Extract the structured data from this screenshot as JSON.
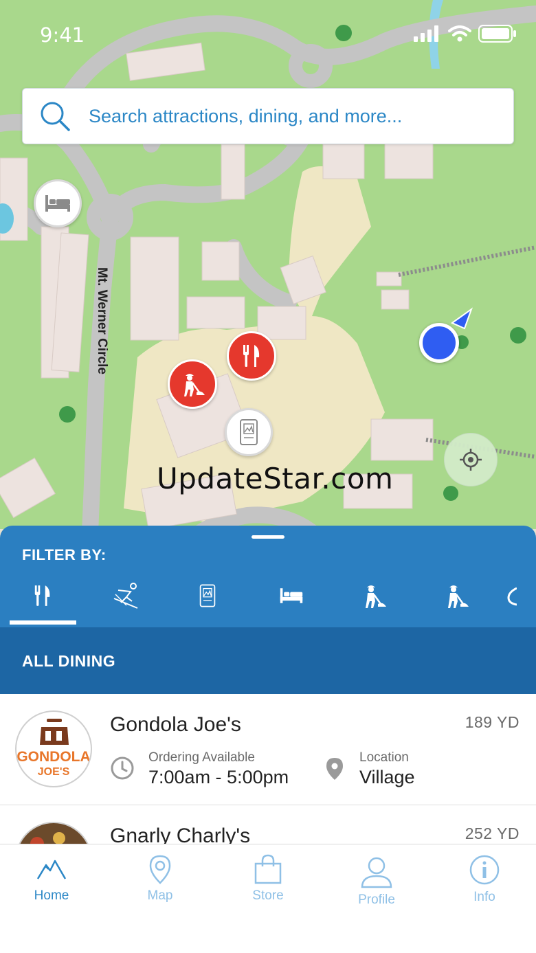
{
  "status_bar": {
    "time": "9:41"
  },
  "search": {
    "placeholder": "Search attractions, dining, and more..."
  },
  "map": {
    "road_label": "Mt. Werner Circle",
    "watermark": "UpdateStar.com",
    "pins": [
      {
        "name": "lodging",
        "icon": "bed-icon",
        "style": "white"
      },
      {
        "name": "dining",
        "icon": "fork-knife-icon",
        "style": "red"
      },
      {
        "name": "trail-work",
        "icon": "worker-icon",
        "style": "red"
      },
      {
        "name": "trail-map",
        "icon": "trail-map-icon",
        "style": "white"
      }
    ]
  },
  "filter": {
    "label": "FILTER BY:",
    "tabs": [
      {
        "name": "dining",
        "icon": "fork-knife-icon",
        "selected": true
      },
      {
        "name": "skiing",
        "icon": "skier-icon",
        "selected": false
      },
      {
        "name": "trail-map",
        "icon": "trail-map-icon",
        "selected": false
      },
      {
        "name": "lodging",
        "icon": "bed-icon",
        "selected": false
      },
      {
        "name": "grooming-1",
        "icon": "worker-icon",
        "selected": false
      },
      {
        "name": "grooming-2",
        "icon": "worker-icon",
        "selected": false
      },
      {
        "name": "more",
        "icon": "partial-icon",
        "selected": false
      }
    ]
  },
  "category": {
    "title": "ALL DINING"
  },
  "list": {
    "items": [
      {
        "name": "Gondola Joe's",
        "distance": "189 YD",
        "hours_label": "Ordering Available",
        "hours_value": "7:00am - 5:00pm",
        "location_label": "Location",
        "location_value": "Village",
        "logo_text_1": "GONDOLA",
        "logo_text_2": "JOE'S"
      },
      {
        "name": "Gnarly Charly's",
        "distance": "252 YD"
      }
    ]
  },
  "tab_bar": {
    "tabs": [
      {
        "label": "Home",
        "icon": "mountain-icon",
        "active": true
      },
      {
        "label": "Map",
        "icon": "map-pin-icon",
        "active": false
      },
      {
        "label": "Store",
        "icon": "shopping-bag-icon",
        "active": false
      },
      {
        "label": "Profile",
        "icon": "user-icon",
        "active": false
      },
      {
        "label": "Info",
        "icon": "info-icon",
        "active": false
      }
    ]
  },
  "colors": {
    "primary_blue": "#2b7fc1",
    "dark_blue": "#1d66a4",
    "link_blue": "#2b87c6",
    "pin_red": "#e5382d",
    "map_green": "#a9d88c"
  }
}
